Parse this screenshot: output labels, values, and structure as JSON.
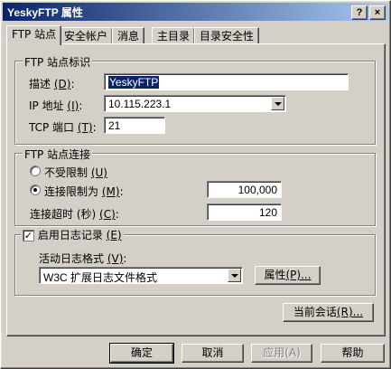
{
  "window": {
    "title": "YeskyFTP 属性",
    "help": "?",
    "close": "×"
  },
  "tabs": [
    "FTP 站点",
    "安全帐户",
    "消息",
    "主目录",
    "目录安全性"
  ],
  "site_id": {
    "legend": "FTP 站点标识",
    "desc_label": "描述",
    "desc_key": "(D)",
    "desc_value": "YeskyFTP",
    "ip_label": "IP 地址",
    "ip_key": "(I)",
    "ip_value": "10.115.223.1",
    "tcp_label": "TCP 端口",
    "tcp_key": "(T)",
    "tcp_value": "21"
  },
  "connection": {
    "legend": "FTP 站点连接",
    "unlimited_label": "不受限制",
    "unlimited_key": "(U)",
    "limited_label": "连接限制为",
    "limited_key": "(M)",
    "limit_value": "100,000",
    "timeout_label": "连接超时 (秒)",
    "timeout_key": "(C)",
    "timeout_value": "120",
    "selected": "limited"
  },
  "logging": {
    "enable_label": "启用日志记录",
    "enable_key": "(E)",
    "enabled": true,
    "format_label": "活动日志格式",
    "format_key": "(V)",
    "format_value": "W3C 扩展日志文件格式",
    "props_label": "属性",
    "props_key": "(P)..."
  },
  "sessions_label": "当前会话",
  "sessions_key": "(R)...",
  "buttons": {
    "ok": "确定",
    "cancel": "取消",
    "apply": "应用",
    "apply_key": "(A)",
    "help": "帮助"
  }
}
